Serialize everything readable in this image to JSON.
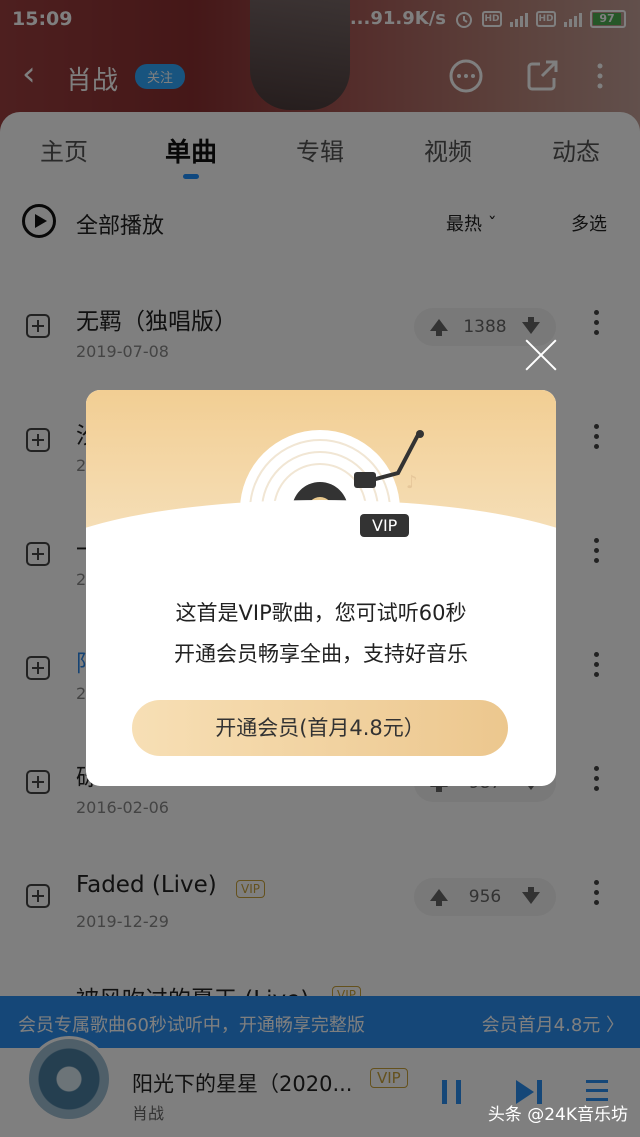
{
  "status_bar": {
    "time": "15:09",
    "speed": "...91.9K/s",
    "hd1": "HD",
    "hd2": "HD",
    "battery": "97"
  },
  "header": {
    "artist": "肖战",
    "follow_label": "关注"
  },
  "tabs": [
    {
      "label": "主页"
    },
    {
      "label": "单曲"
    },
    {
      "label": "专辑"
    },
    {
      "label": "视频"
    },
    {
      "label": "动态"
    }
  ],
  "play_all": {
    "label": "全部播放",
    "sort_label": "最热 ˇ",
    "multi_select_label": "多选"
  },
  "songs": [
    {
      "title": "无羁（独唱版）",
      "date": "2019-07-08",
      "votes": "1388"
    },
    {
      "title": "汐",
      "date": "2",
      "votes": ""
    },
    {
      "title": "一",
      "date": "2",
      "votes": ""
    },
    {
      "title": "阳",
      "date": "2",
      "votes": ""
    },
    {
      "title": "砾",
      "date": "2016-02-06",
      "votes": "987"
    },
    {
      "title": "Faded (Live)",
      "date": "2019-12-29",
      "votes": "956",
      "vip": "VIP"
    },
    {
      "title": "被风吹过的夏天 (Live)",
      "date": "",
      "votes": "",
      "vip": "VIP"
    }
  ],
  "dialog": {
    "vip_badge": "VIP",
    "line1": "这首是VIP歌曲，您可试听60秒",
    "line2": "开通会员畅享全曲，支持好音乐",
    "cta_label": "开通会员(首月4.8元）"
  },
  "vip_banner": {
    "left_text": "会员专属歌曲60秒试听中，开通畅享完整版",
    "right_text": "会员首月4.8元 〉"
  },
  "player": {
    "song_name": "阳光下的星星（2020...",
    "vip": "VIP",
    "singer": "肖战"
  },
  "watermark": "头条 @24K音乐坊",
  "colors": {
    "accent": "#2a8ff0",
    "vip_gold": "#c9a23a",
    "dialog_header": "#f2ce93"
  }
}
